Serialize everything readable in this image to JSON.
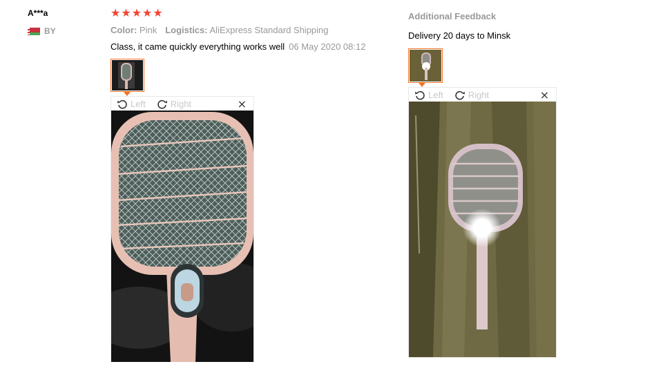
{
  "reviewer": {
    "name": "A***a",
    "country": "BY",
    "flag": "belarus-flag"
  },
  "review": {
    "rating": 5,
    "star_glyph": "★",
    "color_label": "Color:",
    "color_value": "Pink",
    "logistics_label": "Logistics:",
    "logistics_value": "AliExpress Standard Shipping",
    "text": "Class, it came quickly everything works well",
    "date": "06 May 2020 08:12"
  },
  "viewer": {
    "rotate_left": "Left",
    "rotate_right": "Right",
    "close_glyph": "×"
  },
  "additional": {
    "heading": "Additional Feedback",
    "text": "Delivery 20 days to Minsk"
  },
  "colors": {
    "star": "#f44336",
    "accent": "#f57224",
    "muted": "#999999"
  }
}
